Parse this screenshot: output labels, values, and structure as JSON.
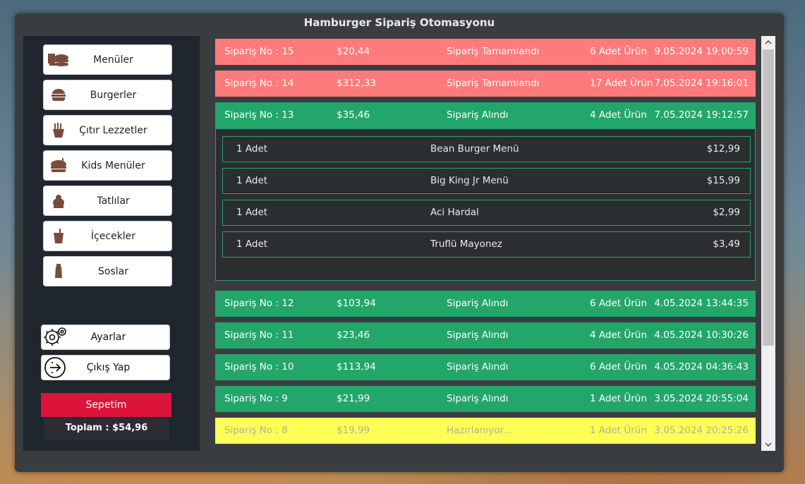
{
  "window": {
    "title": "Hamburger Sipariş Otomasyonu"
  },
  "sidebar": {
    "menu": [
      {
        "label": "Menüler",
        "icon": "burger-menu-icon"
      },
      {
        "label": "Burgerler",
        "icon": "burger-icon"
      },
      {
        "label": "Çıtır Lezzetler",
        "icon": "fries-icon"
      },
      {
        "label": "Kids Menüler",
        "icon": "kids-meal-icon"
      },
      {
        "label": "Tatlılar",
        "icon": "dessert-icon"
      },
      {
        "label": "İçecekler",
        "icon": "drink-icon"
      },
      {
        "label": "Soslar",
        "icon": "sauce-icon"
      }
    ],
    "settings_label": "Ayarlar",
    "logout_label": "Çıkış Yap",
    "cart_label": "Sepetim",
    "total_label": "Toplam : $54,96"
  },
  "orders": [
    {
      "no": "Sipariş No : 15",
      "price": "$20,44",
      "status": "Sipariş Tamamlandı",
      "count": "6 Adet Ürün",
      "date": "9.05.2024 19:00:59",
      "color": "#ff7b7b",
      "text_color": "#ffffff"
    },
    {
      "no": "Sipariş No : 14",
      "price": "$312,33",
      "status": "Sipariş Tamamlandı",
      "count": "17 Adet Ürün",
      "date": "7.05.2024 19:16:01",
      "color": "#ff7b7b",
      "text_color": "#ffffff"
    },
    {
      "no": "Sipariş No : 13",
      "price": "$35,46",
      "status": "Sipariş Alındı",
      "count": "4 Adet Ürün",
      "date": "7.05.2024 19:12:57",
      "color": "#23a66a",
      "text_color": "#ffffff"
    },
    {
      "no": "Sipariş No : 12",
      "price": "$103,94",
      "status": "Sipariş Alındı",
      "count": "6 Adet Ürün",
      "date": "4.05.2024 13:44:35",
      "color": "#23a66a",
      "text_color": "#ffffff"
    },
    {
      "no": "Sipariş No : 11",
      "price": "$23,46",
      "status": "Sipariş Alındı",
      "count": "4 Adet Ürün",
      "date": "4.05.2024 10:30:26",
      "color": "#23a66a",
      "text_color": "#ffffff"
    },
    {
      "no": "Sipariş No : 10",
      "price": "$113,94",
      "status": "Sipariş Alındı",
      "count": "6 Adet Ürün",
      "date": "4.05.2024 04:36:43",
      "color": "#23a66a",
      "text_color": "#ffffff"
    },
    {
      "no": "Sipariş No : 9",
      "price": "$21,99",
      "status": "Sipariş Alındı",
      "count": "1 Adet Ürün",
      "date": "3.05.2024 20:55:04",
      "color": "#23a66a",
      "text_color": "#ffffff"
    },
    {
      "no": "Sipariş No : 8",
      "price": "$19,99",
      "status": "Hazırlanıyor...",
      "count": "1 Adet Ürün",
      "date": "3.05.2024 20:25:26",
      "color": "#ffff55",
      "text_color": "#b0b0a0"
    }
  ],
  "expanded_items": [
    {
      "qty": "1 Adet",
      "name": "Bean Burger Menü",
      "price": "$12,99"
    },
    {
      "qty": "1 Adet",
      "name": "Big King Jr Menü",
      "price": "$15,99"
    },
    {
      "qty": "1 Adet",
      "name": "Aci Hardal",
      "price": "$2,99"
    },
    {
      "qty": "1 Adet",
      "name": "Truflü Mayonez",
      "price": "$3,49"
    }
  ]
}
